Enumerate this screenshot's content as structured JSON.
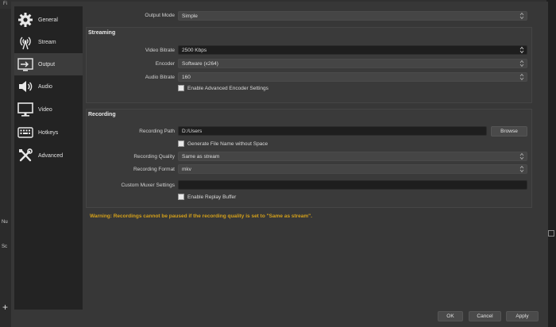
{
  "background": {
    "top_fragment": "Fi",
    "left_fragment_1": "Nu",
    "left_fragment_2": "Sc",
    "plus": "+"
  },
  "sidebar": {
    "items": [
      {
        "label": "General",
        "icon": "gear-icon"
      },
      {
        "label": "Stream",
        "icon": "broadcast-icon"
      },
      {
        "label": "Output",
        "icon": "output-icon",
        "active": true
      },
      {
        "label": "Audio",
        "icon": "speaker-icon"
      },
      {
        "label": "Video",
        "icon": "monitor-icon"
      },
      {
        "label": "Hotkeys",
        "icon": "keyboard-icon"
      },
      {
        "label": "Advanced",
        "icon": "tools-icon"
      }
    ]
  },
  "output_mode": {
    "label": "Output Mode",
    "value": "Simple"
  },
  "streaming": {
    "title": "Streaming",
    "video_bitrate": {
      "label": "Video Bitrate",
      "value": "2500 Kbps"
    },
    "encoder": {
      "label": "Encoder",
      "value": "Software (x264)"
    },
    "audio_bitrate": {
      "label": "Audio Bitrate",
      "value": "160"
    },
    "advanced_encoder": "Enable Advanced Encoder Settings"
  },
  "recording": {
    "title": "Recording",
    "path": {
      "label": "Recording Path",
      "value": "D:/Users"
    },
    "browse": "Browse",
    "no_space": "Generate File Name without Space",
    "quality": {
      "label": "Recording Quality",
      "value": "Same as stream"
    },
    "format": {
      "label": "Recording Format",
      "value": "mkv"
    },
    "muxer": {
      "label": "Custom Muxer Settings",
      "value": ""
    },
    "replay_buffer": "Enable Replay Buffer"
  },
  "warning": "Warning: Recordings cannot be paused if the recording quality is set to \"Same as stream\".",
  "buttons": {
    "ok": "OK",
    "cancel": "Cancel",
    "apply": "Apply"
  },
  "colors": {
    "warning": "#d4a01a",
    "sidebar_bg": "#232323",
    "active_item": "#3c3c3c"
  }
}
